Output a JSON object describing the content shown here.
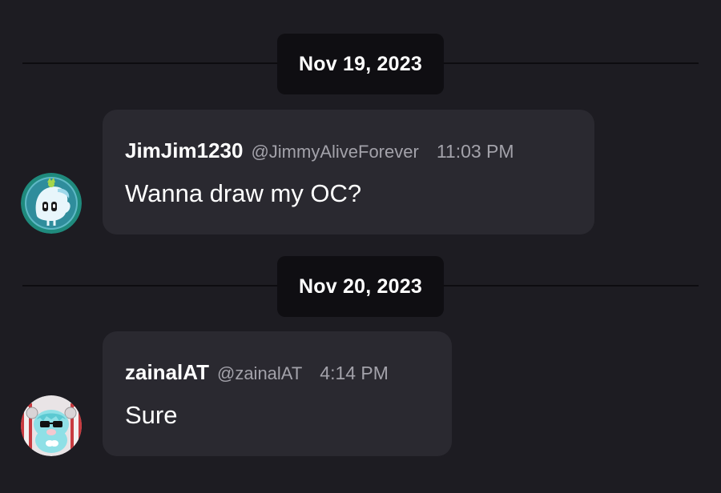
{
  "dates": [
    "Nov 19, 2023",
    "Nov 20, 2023"
  ],
  "messages": [
    {
      "name": "JimJim1230",
      "handle": "@JimmyAliveForever",
      "time": "11:03 PM",
      "text": "Wanna draw my OC?",
      "avatar": "teal-ghost-avatar"
    },
    {
      "name": "zainalAT",
      "handle": "@zainalAT",
      "time": "4:14 PM",
      "text": "Sure",
      "avatar": "cyan-character-avatar"
    }
  ],
  "colors": {
    "background": "#1d1c22",
    "bubble": "#2a2930",
    "date_pill": "#0f0e12",
    "muted_text": "#a3a2aa"
  }
}
